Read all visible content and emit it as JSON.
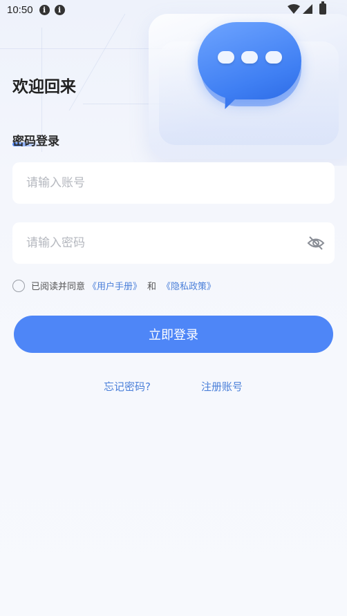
{
  "status_bar": {
    "time": "10:50",
    "info_glyph": "i",
    "icons": [
      "info-icon",
      "info-icon",
      "wifi-icon",
      "cellular-signal-icon",
      "battery-icon"
    ]
  },
  "header": {
    "title": "欢迎回来"
  },
  "login_tab": {
    "label": "密码登录"
  },
  "form": {
    "account_placeholder": "请输入账号",
    "account_value": "",
    "password_placeholder": "请输入密码",
    "password_value": "",
    "password_toggle_icon": "eye-off-icon"
  },
  "agreement": {
    "checked": false,
    "prefix": "已阅读并同意",
    "user_manual_link": "《用户手册》",
    "connector": "和",
    "privacy_link": "《隐私政策》"
  },
  "actions": {
    "login_button": "立即登录",
    "forgot_password": "忘记密码?",
    "register": "注册账号"
  },
  "colors": {
    "accent": "#4e86f7",
    "link": "#4a7fd9",
    "background": "#f6f8fd"
  }
}
